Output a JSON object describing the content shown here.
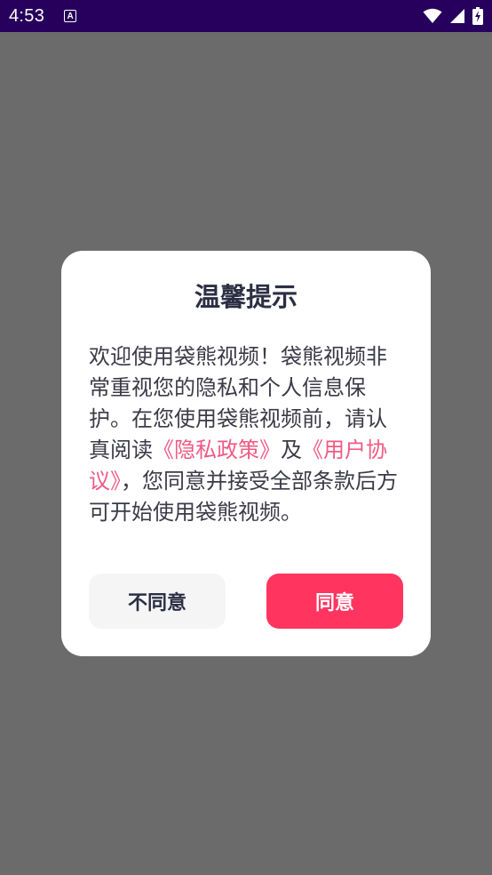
{
  "status_bar": {
    "time": "4:53",
    "notification_letter": "A",
    "icons": [
      "wifi-icon",
      "signal-icon",
      "battery-charging-icon"
    ]
  },
  "dialog": {
    "title": "温馨提示",
    "body": {
      "part1": "欢迎使用袋熊视频！袋熊视频非常重视您的隐私和个人信息保护。在您使用袋熊视频前，请认真阅读",
      "privacy_link": "《隐私政策》",
      "part2": "及",
      "terms_link": "《用户协议》",
      "part3": "，您同意并接受全部条款后方可开始使用袋熊视频。"
    },
    "disagree_label": "不同意",
    "agree_label": "同意"
  },
  "colors": {
    "overlay": "#6b6b6b",
    "status_bar": "#26005c",
    "link": "#f05a84",
    "agree_button": "#ff3560",
    "disagree_button": "#f5f5f6"
  }
}
